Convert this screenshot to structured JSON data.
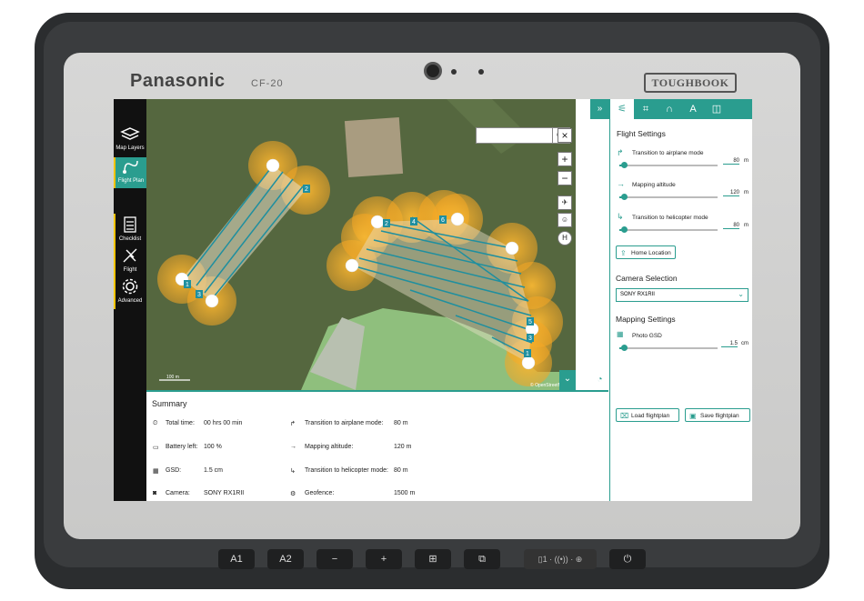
{
  "device": {
    "brand": "Panasonic",
    "model": "CF-20",
    "series": "TOUGHBOOK"
  },
  "hardware_buttons": [
    {
      "label": "A1"
    },
    {
      "label": "A2"
    },
    {
      "label": "−"
    },
    {
      "label": "+"
    },
    {
      "label": "⊞"
    },
    {
      "label": "⧉"
    }
  ],
  "nav": {
    "map_layers": "Map Layers",
    "flight_plan": "Flight Plan",
    "checklist": "Checklist",
    "flight": "Flight",
    "advanced": "Advanced"
  },
  "map": {
    "search_placeholder": "",
    "scale_label": "100 m",
    "attribution": "© OpenStreetMap",
    "waypoint_labels": [
      "1",
      "2",
      "3",
      "2",
      "4",
      "6",
      "5",
      "3",
      "1"
    ]
  },
  "summary": {
    "title": "Summary",
    "rows": [
      {
        "label": "Total time:",
        "value": "00 hrs 00 min"
      },
      {
        "label": "Battery left:",
        "value": "100 %"
      },
      {
        "label": "GSD:",
        "value": "1.5 cm"
      },
      {
        "label": "Camera:",
        "value": "SONY RX1RII"
      }
    ],
    "rows2": [
      {
        "label": "Transition to airplane mode:",
        "value": "80 m"
      },
      {
        "label": "Mapping altitude:",
        "value": "120 m"
      },
      {
        "label": "Transition to helicopter mode:",
        "value": "80 m"
      },
      {
        "label": "Geofence:",
        "value": "1500 m"
      }
    ]
  },
  "panel": {
    "flight_settings": "Flight Settings",
    "settings": [
      {
        "label": "Transition to airplane mode",
        "value": "80",
        "unit": "m",
        "level": 0.05
      },
      {
        "label": "Mapping altitude",
        "value": "120",
        "unit": "m",
        "level": 0.05
      },
      {
        "label": "Transition to helicopter mode",
        "value": "80",
        "unit": "m",
        "level": 0.05
      }
    ],
    "home_location": "Home Location",
    "camera_selection": "Camera Selection",
    "camera_value": "SONY RX1RII",
    "mapping_settings": "Mapping Settings",
    "photo_gsd": {
      "label": "Photo GSD",
      "value": "1.5",
      "unit": "cm",
      "level": 0.05
    },
    "load_flightplan": "Load flightplan",
    "save_flightplan": "Save flightplan"
  },
  "colors": {
    "accent": "#2a9d8f",
    "waypoint_zone": "#f5a623"
  }
}
